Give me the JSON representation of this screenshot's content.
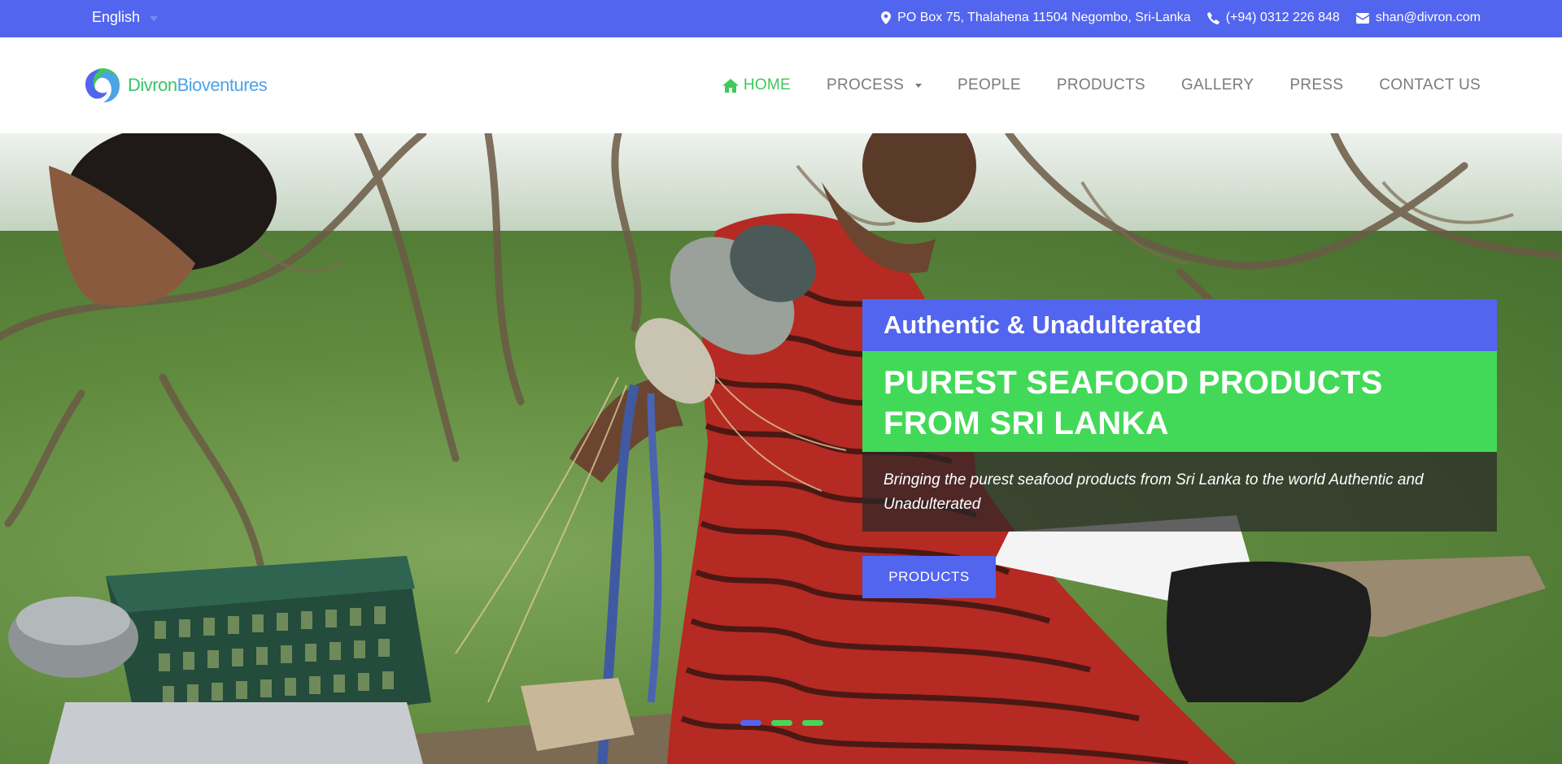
{
  "topbar": {
    "language": "English",
    "address": "PO Box 75, Thalahena 11504 Negombo, Sri-Lanka",
    "phone": "(+94) 0312 226 848",
    "email": "shan@divron.com"
  },
  "logo": {
    "part1": "Divron",
    "part2": "Bioventures"
  },
  "nav": {
    "items": [
      {
        "label": "HOME"
      },
      {
        "label": "PROCESS"
      },
      {
        "label": "PEOPLE"
      },
      {
        "label": "PRODUCTS"
      },
      {
        "label": "GALLERY"
      },
      {
        "label": "PRESS"
      },
      {
        "label": "CONTACT US"
      }
    ]
  },
  "hero": {
    "tagline": "Authentic & Unadulterated",
    "headline_line1": "PUREST SEAFOOD PRODUCTS",
    "headline_line2": "FROM SRI LANKA",
    "description": "Bringing the purest seafood products from Sri Lanka to the world Authentic and Unadulterated",
    "button_label": "PRODUCTS"
  },
  "colors": {
    "brand_blue": "#5265ef",
    "brand_green": "#43d958",
    "nav_text": "#7b7b7b"
  }
}
